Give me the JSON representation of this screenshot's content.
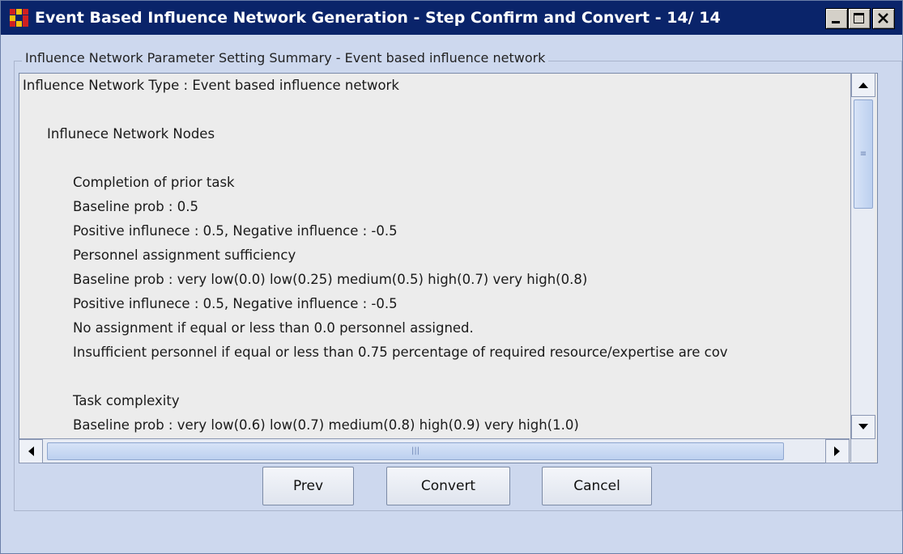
{
  "window": {
    "title": "Event Based Influence Network Generation - Step Confirm and Convert - 14/ 14",
    "controls": [
      "minimize-icon",
      "maximize-icon",
      "close-icon"
    ]
  },
  "panel": {
    "legend": "Influence Network Parameter Setting Summary - Event based influence network"
  },
  "summary_lines": [
    "Influence Network Type : Event based influence network",
    "",
    "Influnece Network Nodes",
    "",
    "Completion of prior task",
    "Baseline prob : 0.5",
    "Positive influnece : 0.5, Negative influence : -0.5",
    "Personnel assignment sufficiency",
    "Baseline prob : very low(0.0)  low(0.25)  medium(0.5)  high(0.7)  very high(0.8)",
    "Positive influnece : 0.5, Negative influence : -0.5",
    "No assignment if equal or less than 0.0 personnel assigned.",
    "Insufficient personnel if equal or less than 0.75 percentage of required resource/expertise are cov",
    "",
    "Task complexity",
    "Baseline prob : very low(0.6)  low(0.7)  medium(0.8)  high(0.9)  very high(1.0)"
  ],
  "buttons": {
    "prev": "Prev",
    "convert": "Convert",
    "cancel": "Cancel"
  },
  "colors": {
    "titlebar": "#0a246a",
    "window_bg": "#cdd8ee",
    "text_area_bg": "#ececec"
  }
}
